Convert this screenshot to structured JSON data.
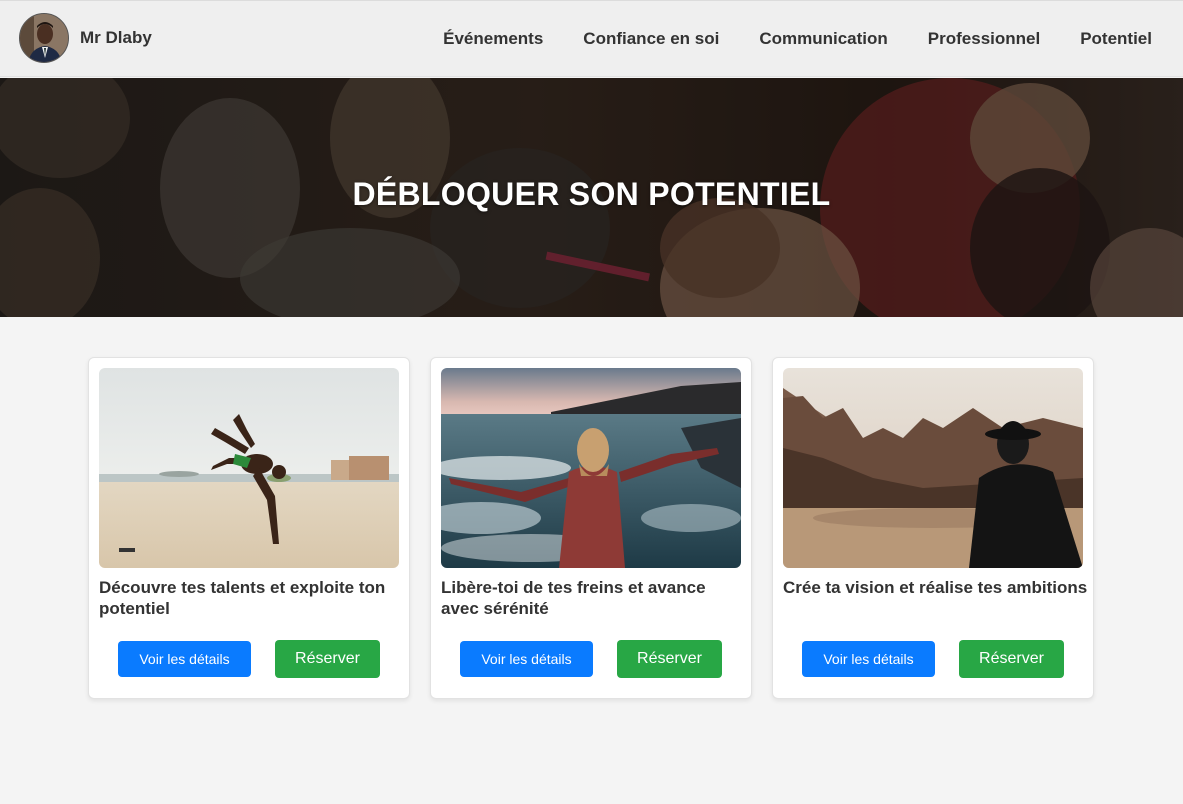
{
  "brand": {
    "name": "Mr Dlaby",
    "avatar_icon": "person-avatar"
  },
  "nav": {
    "items": [
      {
        "label": "Événements"
      },
      {
        "label": "Confiance en soi"
      },
      {
        "label": "Communication"
      },
      {
        "label": "Professionnel"
      },
      {
        "label": "Potentiel"
      }
    ]
  },
  "hero": {
    "title": "DÉBLOQUER SON POTENTIEL"
  },
  "cards": [
    {
      "title": "Découvre tes talents et exploite ton potentiel",
      "image": "beach-handstand-photo",
      "details_label": "Voir les détails",
      "book_label": "Réserver"
    },
    {
      "title": "Libère-toi de tes freins et avance avec sérénité",
      "image": "sea-open-arms-photo",
      "details_label": "Voir les détails",
      "book_label": "Réserver"
    },
    {
      "title": "Crée ta vision et réalise tes ambitions",
      "image": "canyon-hat-photo",
      "details_label": "Voir les détails",
      "book_label": "Réserver"
    }
  ],
  "colors": {
    "primary_button": "#0a7bff",
    "success_button": "#28a745",
    "navbar_bg": "#efefef",
    "page_bg": "#f4f4f4"
  }
}
